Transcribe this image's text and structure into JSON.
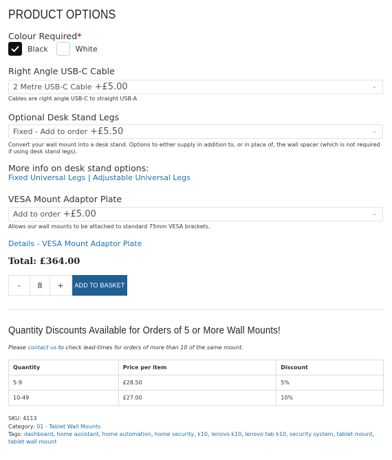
{
  "title": "PRODUCT OPTIONS",
  "colour": {
    "label": "Colour Required",
    "required_mark": "*",
    "options": [
      {
        "label": "Black",
        "checked": true
      },
      {
        "label": "White",
        "checked": false
      }
    ]
  },
  "usb_cable": {
    "label": "Right Angle USB-C Cable",
    "selected_text": "2 Metre USB-C Cable",
    "selected_price": "+£5.00",
    "note": "Cables are right angle USB-C to straight USB-A"
  },
  "desk_legs": {
    "label": "Optional Desk Stand Legs",
    "selected_text": "Fixed - Add to order",
    "selected_price": "+£5.50",
    "note": "Convert your wall mount into a desk stand. Options to either supply in addition to, or in place of, the wall spacer (which is not required if using desk stand legs)."
  },
  "more_info": {
    "label": "More info on desk stand options:",
    "link1": "Fixed Universal Legs",
    "separator": "|",
    "link2": "Adjustable Universal Legs"
  },
  "vesa": {
    "label": "VESA Mount Adaptor Plate",
    "selected_text": "Add to order",
    "selected_price": "+£5.00",
    "note": "Allows our wall mounts to be attached to standard 75mm VESA brackets.",
    "details_link": "Details - VESA Mount Adaptor Plate"
  },
  "total": "Total: £364.00",
  "quantity": {
    "minus": "-",
    "value": "8",
    "plus": "+"
  },
  "add_to_basket": "ADD TO BASKET",
  "discounts": {
    "title": "Quantity Discounts Available for Orders of 5 or More Wall Mounts!",
    "note_prefix": "Please",
    "note_link": "contact us",
    "note_suffix": "to check lead-times for orders of more than 10 of the same mount.",
    "headers": [
      "Quantity",
      "Price per item",
      "Discount"
    ],
    "rows": [
      [
        "5-9",
        "£28.50",
        "5%"
      ],
      [
        "10-49",
        "£27.00",
        "10%"
      ]
    ]
  },
  "meta": {
    "sku_label": "SKU:",
    "sku": "4113",
    "category_label": "Category:",
    "category": "01 - Tablet Wall Mounts",
    "tags_label": "Tags:",
    "tags": [
      "dashboard",
      "home assistant",
      "home automation",
      "home security",
      "k10",
      "lenovo k10",
      "lenovo tab k10",
      "security system",
      "tablet mount",
      "tablet wall mount"
    ]
  },
  "colors": {
    "link": "#1a6fb0",
    "button": "#1f5f94",
    "required": "#c0392b"
  }
}
